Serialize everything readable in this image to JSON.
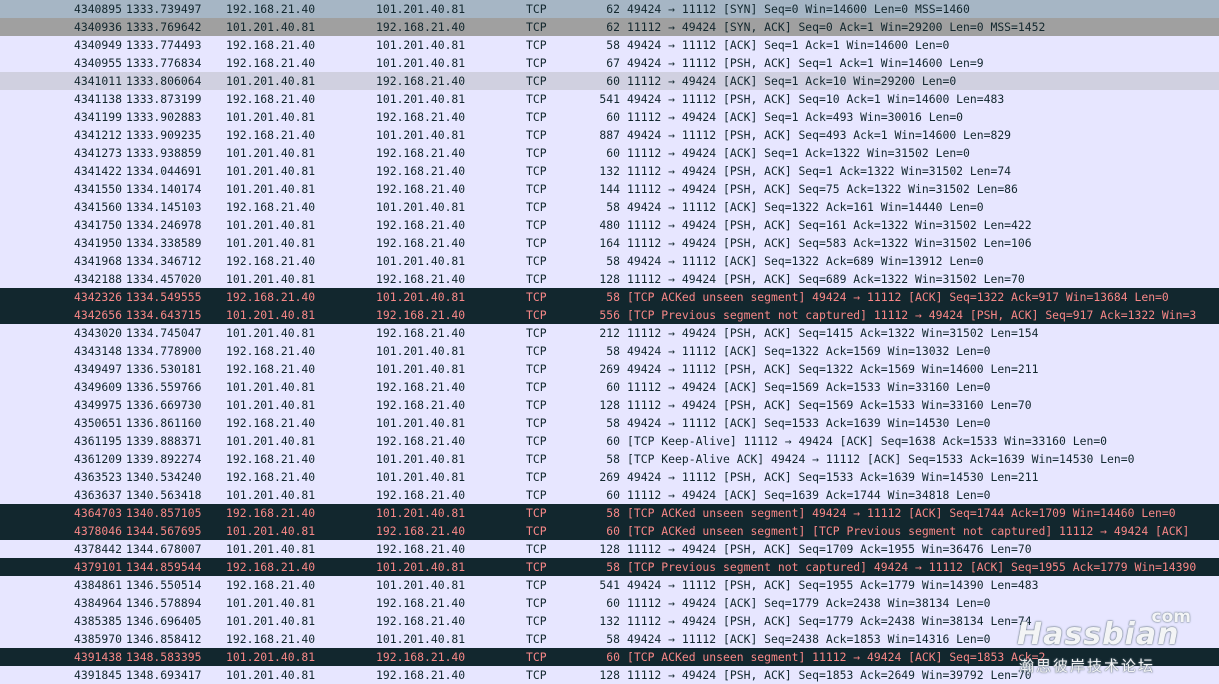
{
  "packets": [
    {
      "no": "4340895",
      "time": "1333.739497",
      "src": "192.168.21.40",
      "dst": "101.201.40.81",
      "proto": "TCP",
      "len": "62",
      "info": "49424 → 11112 [SYN] Seq=0 Win=14600 Len=0 MSS=1460",
      "style": "sel"
    },
    {
      "no": "4340936",
      "time": "1333.769642",
      "src": "101.201.40.81",
      "dst": "192.168.21.40",
      "proto": "TCP",
      "len": "62",
      "info": "11112 → 49424 [SYN, ACK] Seq=0 Ack=1 Win=29200 Len=0 MSS=1452",
      "style": "syn"
    },
    {
      "no": "4340949",
      "time": "1333.774493",
      "src": "192.168.21.40",
      "dst": "101.201.40.81",
      "proto": "TCP",
      "len": "58",
      "info": "49424 → 11112 [ACK] Seq=1 Ack=1 Win=14600 Len=0",
      "style": "tcp"
    },
    {
      "no": "4340955",
      "time": "1333.776834",
      "src": "192.168.21.40",
      "dst": "101.201.40.81",
      "proto": "TCP",
      "len": "67",
      "info": "49424 → 11112 [PSH, ACK] Seq=1 Ack=1 Win=14600 Len=9",
      "style": "tcp"
    },
    {
      "no": "4341011",
      "time": "1333.806064",
      "src": "101.201.40.81",
      "dst": "192.168.21.40",
      "proto": "TCP",
      "len": "60",
      "info": "11112 → 49424 [ACK] Seq=1 Ack=10 Win=29200 Len=0",
      "style": "lt"
    },
    {
      "no": "4341138",
      "time": "1333.873199",
      "src": "192.168.21.40",
      "dst": "101.201.40.81",
      "proto": "TCP",
      "len": "541",
      "info": "49424 → 11112 [PSH, ACK] Seq=10 Ack=1 Win=14600 Len=483",
      "style": "tcp"
    },
    {
      "no": "4341199",
      "time": "1333.902883",
      "src": "101.201.40.81",
      "dst": "192.168.21.40",
      "proto": "TCP",
      "len": "60",
      "info": "11112 → 49424 [ACK] Seq=1 Ack=493 Win=30016 Len=0",
      "style": "tcp"
    },
    {
      "no": "4341212",
      "time": "1333.909235",
      "src": "192.168.21.40",
      "dst": "101.201.40.81",
      "proto": "TCP",
      "len": "887",
      "info": "49424 → 11112 [PSH, ACK] Seq=493 Ack=1 Win=14600 Len=829",
      "style": "tcp"
    },
    {
      "no": "4341273",
      "time": "1333.938859",
      "src": "101.201.40.81",
      "dst": "192.168.21.40",
      "proto": "TCP",
      "len": "60",
      "info": "11112 → 49424 [ACK] Seq=1 Ack=1322 Win=31502 Len=0",
      "style": "tcp"
    },
    {
      "no": "4341422",
      "time": "1334.044691",
      "src": "101.201.40.81",
      "dst": "192.168.21.40",
      "proto": "TCP",
      "len": "132",
      "info": "11112 → 49424 [PSH, ACK] Seq=1 Ack=1322 Win=31502 Len=74",
      "style": "tcp"
    },
    {
      "no": "4341550",
      "time": "1334.140174",
      "src": "101.201.40.81",
      "dst": "192.168.21.40",
      "proto": "TCP",
      "len": "144",
      "info": "11112 → 49424 [PSH, ACK] Seq=75 Ack=1322 Win=31502 Len=86",
      "style": "tcp"
    },
    {
      "no": "4341560",
      "time": "1334.145103",
      "src": "192.168.21.40",
      "dst": "101.201.40.81",
      "proto": "TCP",
      "len": "58",
      "info": "49424 → 11112 [ACK] Seq=1322 Ack=161 Win=14440 Len=0",
      "style": "tcp"
    },
    {
      "no": "4341750",
      "time": "1334.246978",
      "src": "101.201.40.81",
      "dst": "192.168.21.40",
      "proto": "TCP",
      "len": "480",
      "info": "11112 → 49424 [PSH, ACK] Seq=161 Ack=1322 Win=31502 Len=422",
      "style": "tcp"
    },
    {
      "no": "4341950",
      "time": "1334.338589",
      "src": "101.201.40.81",
      "dst": "192.168.21.40",
      "proto": "TCP",
      "len": "164",
      "info": "11112 → 49424 [PSH, ACK] Seq=583 Ack=1322 Win=31502 Len=106",
      "style": "tcp"
    },
    {
      "no": "4341968",
      "time": "1334.346712",
      "src": "192.168.21.40",
      "dst": "101.201.40.81",
      "proto": "TCP",
      "len": "58",
      "info": "49424 → 11112 [ACK] Seq=1322 Ack=689 Win=13912 Len=0",
      "style": "tcp"
    },
    {
      "no": "4342188",
      "time": "1334.457020",
      "src": "101.201.40.81",
      "dst": "192.168.21.40",
      "proto": "TCP",
      "len": "128",
      "info": "11112 → 49424 [PSH, ACK] Seq=689 Ack=1322 Win=31502 Len=70",
      "style": "tcp"
    },
    {
      "no": "4342326",
      "time": "1334.549555",
      "src": "192.168.21.40",
      "dst": "101.201.40.81",
      "proto": "TCP",
      "len": "58",
      "info": "[TCP ACKed unseen segment] 49424 → 11112 [ACK] Seq=1322 Ack=917 Win=13684 Len=0",
      "style": "bad"
    },
    {
      "no": "4342656",
      "time": "1334.643715",
      "src": "101.201.40.81",
      "dst": "192.168.21.40",
      "proto": "TCP",
      "len": "556",
      "info": "[TCP Previous segment not captured] 11112 → 49424 [PSH, ACK] Seq=917 Ack=1322 Win=3",
      "style": "bad"
    },
    {
      "no": "4343020",
      "time": "1334.745047",
      "src": "101.201.40.81",
      "dst": "192.168.21.40",
      "proto": "TCP",
      "len": "212",
      "info": "11112 → 49424 [PSH, ACK] Seq=1415 Ack=1322 Win=31502 Len=154",
      "style": "tcp"
    },
    {
      "no": "4343148",
      "time": "1334.778900",
      "src": "192.168.21.40",
      "dst": "101.201.40.81",
      "proto": "TCP",
      "len": "58",
      "info": "49424 → 11112 [ACK] Seq=1322 Ack=1569 Win=13032 Len=0",
      "style": "tcp"
    },
    {
      "no": "4349497",
      "time": "1336.530181",
      "src": "192.168.21.40",
      "dst": "101.201.40.81",
      "proto": "TCP",
      "len": "269",
      "info": "49424 → 11112 [PSH, ACK] Seq=1322 Ack=1569 Win=14600 Len=211",
      "style": "tcp"
    },
    {
      "no": "4349609",
      "time": "1336.559766",
      "src": "101.201.40.81",
      "dst": "192.168.21.40",
      "proto": "TCP",
      "len": "60",
      "info": "11112 → 49424 [ACK] Seq=1569 Ack=1533 Win=33160 Len=0",
      "style": "tcp"
    },
    {
      "no": "4349975",
      "time": "1336.669730",
      "src": "101.201.40.81",
      "dst": "192.168.21.40",
      "proto": "TCP",
      "len": "128",
      "info": "11112 → 49424 [PSH, ACK] Seq=1569 Ack=1533 Win=33160 Len=70",
      "style": "tcp"
    },
    {
      "no": "4350651",
      "time": "1336.861160",
      "src": "192.168.21.40",
      "dst": "101.201.40.81",
      "proto": "TCP",
      "len": "58",
      "info": "49424 → 11112 [ACK] Seq=1533 Ack=1639 Win=14530 Len=0",
      "style": "tcp"
    },
    {
      "no": "4361195",
      "time": "1339.888371",
      "src": "101.201.40.81",
      "dst": "192.168.21.40",
      "proto": "TCP",
      "len": "60",
      "info": "[TCP Keep-Alive] 11112 → 49424 [ACK] Seq=1638 Ack=1533 Win=33160 Len=0",
      "style": "tcp"
    },
    {
      "no": "4361209",
      "time": "1339.892274",
      "src": "192.168.21.40",
      "dst": "101.201.40.81",
      "proto": "TCP",
      "len": "58",
      "info": "[TCP Keep-Alive ACK] 49424 → 11112 [ACK] Seq=1533 Ack=1639 Win=14530 Len=0",
      "style": "tcp"
    },
    {
      "no": "4363523",
      "time": "1340.534240",
      "src": "192.168.21.40",
      "dst": "101.201.40.81",
      "proto": "TCP",
      "len": "269",
      "info": "49424 → 11112 [PSH, ACK] Seq=1533 Ack=1639 Win=14530 Len=211",
      "style": "tcp"
    },
    {
      "no": "4363637",
      "time": "1340.563418",
      "src": "101.201.40.81",
      "dst": "192.168.21.40",
      "proto": "TCP",
      "len": "60",
      "info": "11112 → 49424 [ACK] Seq=1639 Ack=1744 Win=34818 Len=0",
      "style": "tcp"
    },
    {
      "no": "4364703",
      "time": "1340.857105",
      "src": "192.168.21.40",
      "dst": "101.201.40.81",
      "proto": "TCP",
      "len": "58",
      "info": "[TCP ACKed unseen segment] 49424 → 11112 [ACK] Seq=1744 Ack=1709 Win=14460 Len=0",
      "style": "bad"
    },
    {
      "no": "4378046",
      "time": "1344.567695",
      "src": "101.201.40.81",
      "dst": "192.168.21.40",
      "proto": "TCP",
      "len": "60",
      "info": "[TCP ACKed unseen segment] [TCP Previous segment not captured] 11112 → 49424 [ACK]",
      "style": "bad"
    },
    {
      "no": "4378442",
      "time": "1344.678007",
      "src": "101.201.40.81",
      "dst": "192.168.21.40",
      "proto": "TCP",
      "len": "128",
      "info": "11112 → 49424 [PSH, ACK] Seq=1709 Ack=1955 Win=36476 Len=70",
      "style": "tcp"
    },
    {
      "no": "4379101",
      "time": "1344.859544",
      "src": "192.168.21.40",
      "dst": "101.201.40.81",
      "proto": "TCP",
      "len": "58",
      "info": "[TCP Previous segment not captured] 49424 → 11112 [ACK] Seq=1955 Ack=1779 Win=14390",
      "style": "bad"
    },
    {
      "no": "4384861",
      "time": "1346.550514",
      "src": "192.168.21.40",
      "dst": "101.201.40.81",
      "proto": "TCP",
      "len": "541",
      "info": "49424 → 11112 [PSH, ACK] Seq=1955 Ack=1779 Win=14390 Len=483",
      "style": "tcp"
    },
    {
      "no": "4384964",
      "time": "1346.578894",
      "src": "101.201.40.81",
      "dst": "192.168.21.40",
      "proto": "TCP",
      "len": "60",
      "info": "11112 → 49424 [ACK] Seq=1779 Ack=2438 Win=38134 Len=0",
      "style": "tcp"
    },
    {
      "no": "4385385",
      "time": "1346.696405",
      "src": "101.201.40.81",
      "dst": "192.168.21.40",
      "proto": "TCP",
      "len": "132",
      "info": "11112 → 49424 [PSH, ACK] Seq=1779 Ack=2438 Win=38134 Len=74",
      "style": "tcp"
    },
    {
      "no": "4385970",
      "time": "1346.858412",
      "src": "192.168.21.40",
      "dst": "101.201.40.81",
      "proto": "TCP",
      "len": "58",
      "info": "49424 → 11112 [ACK] Seq=2438 Ack=1853 Win=14316 Len=0",
      "style": "tcp"
    },
    {
      "no": "4391438",
      "time": "1348.583395",
      "src": "101.201.40.81",
      "dst": "192.168.21.40",
      "proto": "TCP",
      "len": "60",
      "info": "[TCP ACKed unseen segment] 11112 → 49424 [ACK] Seq=1853 Ack=2",
      "style": "bad"
    },
    {
      "no": "4391845",
      "time": "1348.693417",
      "src": "101.201.40.81",
      "dst": "192.168.21.40",
      "proto": "TCP",
      "len": "128",
      "info": "11112 → 49424 [PSH, ACK] Seq=1853 Ack=2649 Win=39792 Len=70",
      "style": "tcp"
    }
  ],
  "row_colors": {
    "tcp": "#e7e6ff",
    "syn": "#a0a0a0",
    "selected": "#a6b6c5",
    "bad_bg": "#12272e",
    "bad_fg": "#f78787"
  },
  "watermark": {
    "com": "com",
    "logo": "Hassbian",
    "cn": "瀚思彼岸技术论坛"
  }
}
